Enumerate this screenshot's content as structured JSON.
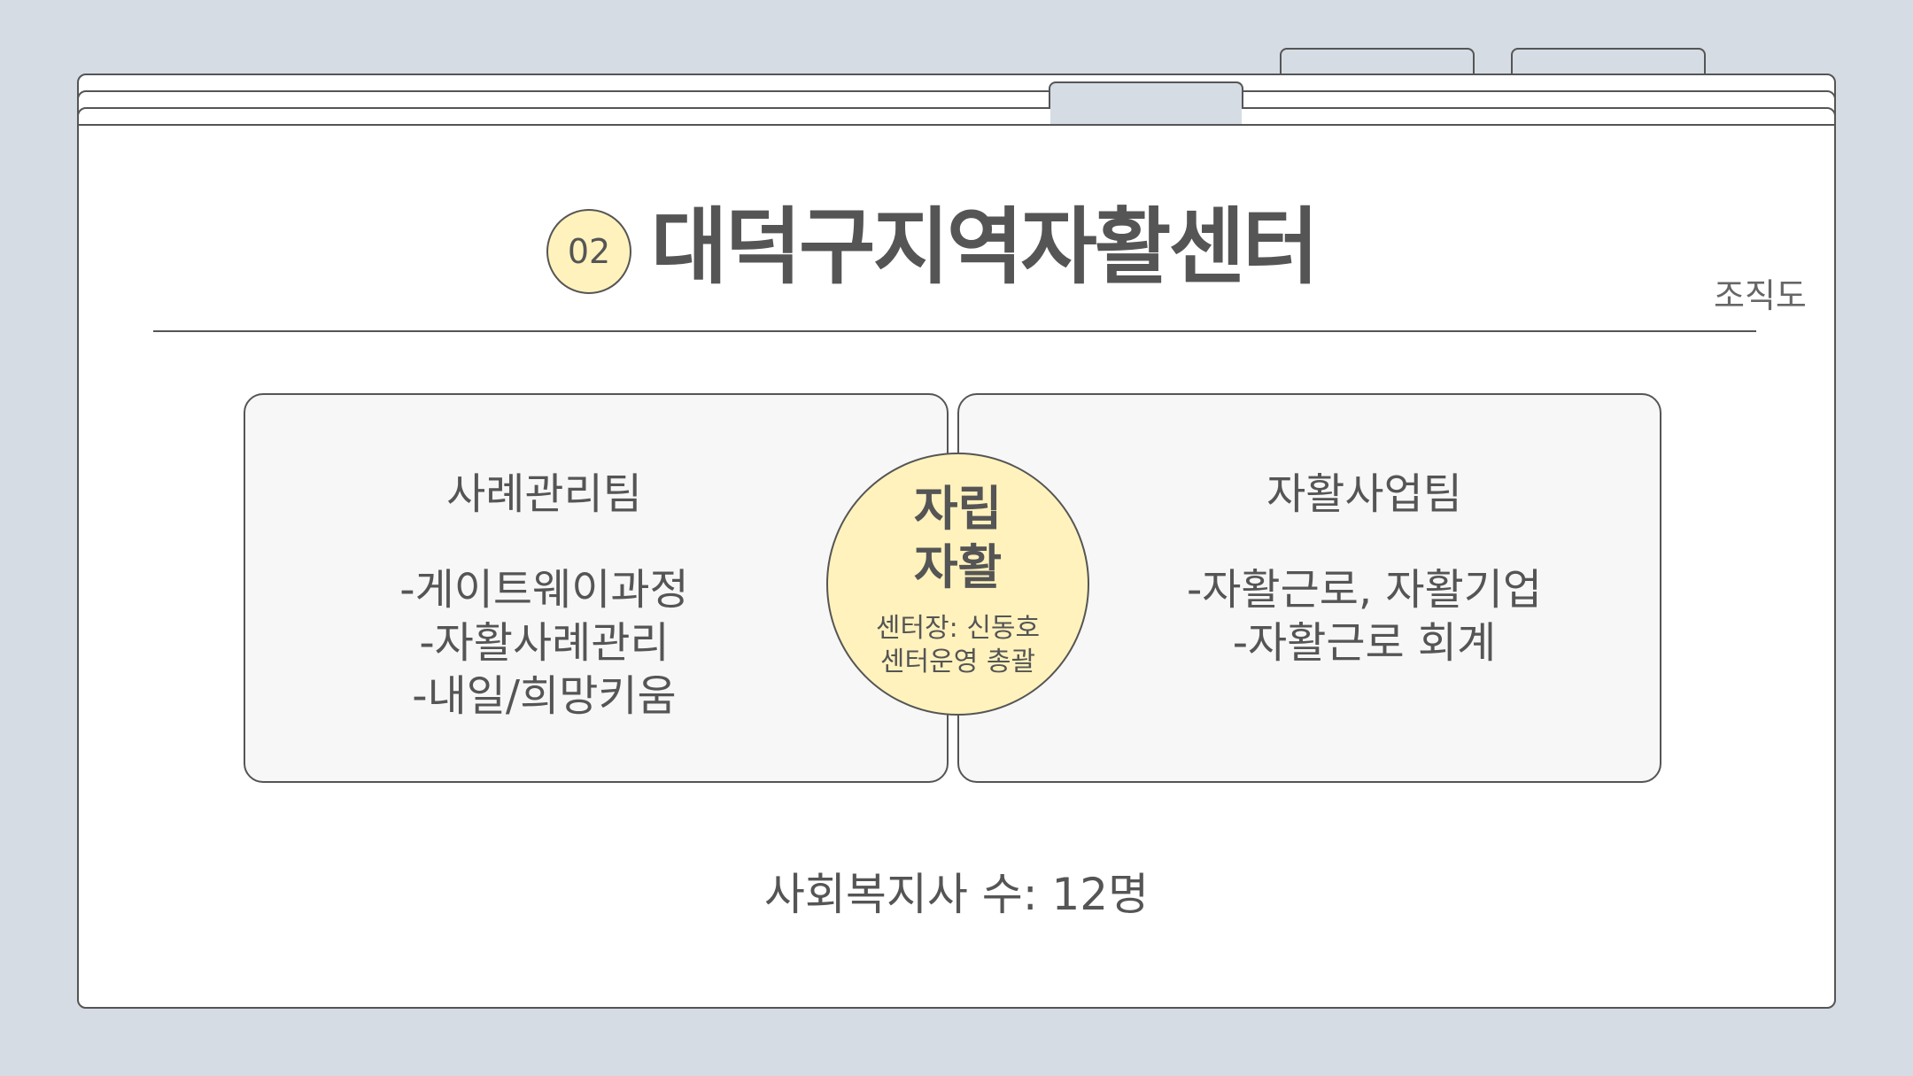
{
  "badge": "02",
  "title": "대덕구지역자활센터",
  "subtitle": "조직도",
  "left_panel": {
    "title": "사례관리팀",
    "items": [
      "-게이트웨이과정",
      "-자활사례관리",
      "-내일/희망키움"
    ]
  },
  "right_panel": {
    "title": "자활사업팀",
    "items": [
      "-자활근로, 자활기업",
      "-자활근로 회계"
    ]
  },
  "center": {
    "line1": "자립",
    "line2": "자활",
    "sub1": "센터장: 신동호",
    "sub2": "센터운영 총괄"
  },
  "footer": "사회복지사 수: 12명",
  "colors": {
    "background": "#d5dce4",
    "sheet": "#ffffff",
    "panel": "#f7f7f7",
    "accent": "#fff2bd",
    "text": "#555555"
  }
}
